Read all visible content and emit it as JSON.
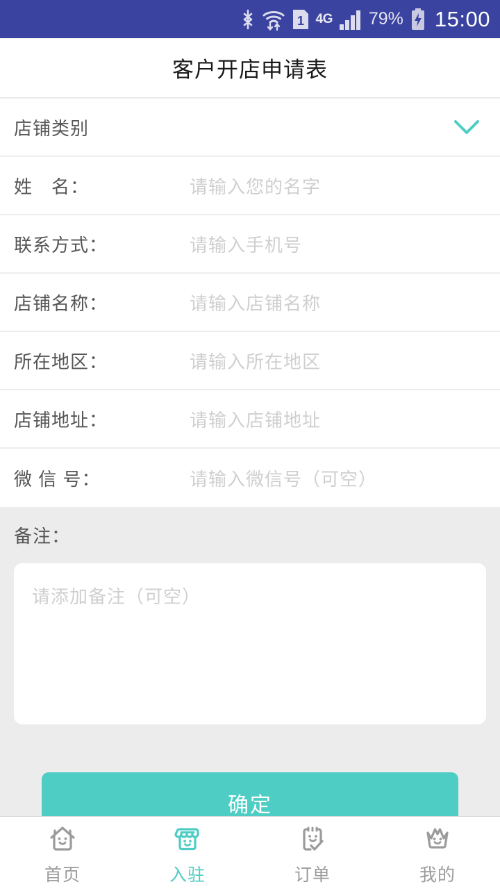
{
  "status_bar": {
    "background_color": "#3a43a0",
    "icons": [
      "bluetooth-icon",
      "wifi-icon",
      "sim1-icon",
      "signal-icon",
      "battery-charging-icon"
    ],
    "network_label": "4G",
    "battery_percent": "79%",
    "clock": "15:00"
  },
  "header": {
    "title": "客户开店申请表"
  },
  "form": {
    "category_row": {
      "label": "店铺类别",
      "icon": "chevron-down-icon",
      "accent_color": "#4ecdc4"
    },
    "rows": [
      {
        "label": "姓　名：",
        "placeholder": "请输入您的名字",
        "value": ""
      },
      {
        "label": "联系方式：",
        "placeholder": "请输入手机号",
        "value": ""
      },
      {
        "label": "店铺名称：",
        "placeholder": "请输入店铺名称",
        "value": ""
      },
      {
        "label": "所在地区：",
        "placeholder": "请输入所在地区",
        "value": ""
      },
      {
        "label": "店铺地址：",
        "placeholder": "请输入店铺地址",
        "value": ""
      },
      {
        "label": "微 信 号：",
        "placeholder": "请输入微信号（可空）",
        "value": ""
      }
    ],
    "remark": {
      "label": "备注：",
      "placeholder": "请添加备注（可空）",
      "value": ""
    },
    "submit_label": "确定",
    "submit_color": "#4ecdc4"
  },
  "bottom_nav": {
    "active_index": 1,
    "active_color": "#4ecdc4",
    "inactive_color": "#9b9b9b",
    "items": [
      {
        "label": "首页",
        "icon": "home-icon"
      },
      {
        "label": "入驻",
        "icon": "shop-icon"
      },
      {
        "label": "订单",
        "icon": "order-clipboard-icon"
      },
      {
        "label": "我的",
        "icon": "crown-icon"
      }
    ]
  }
}
